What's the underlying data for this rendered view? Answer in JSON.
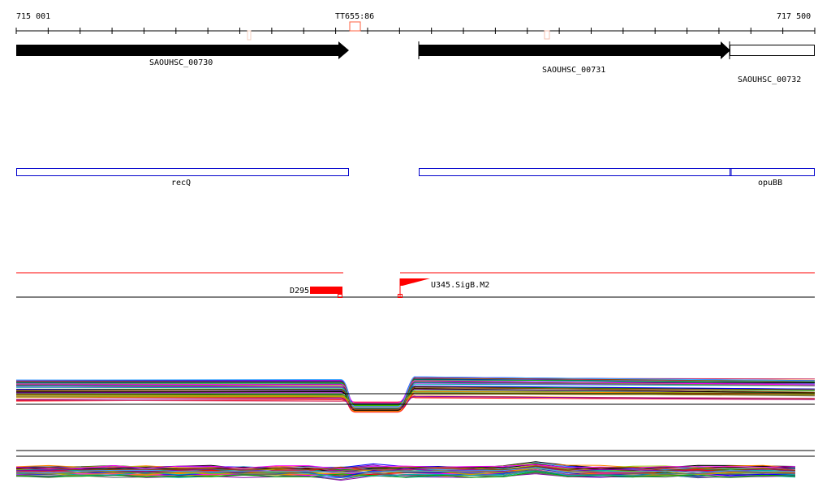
{
  "ruler": {
    "start_label": "715 001",
    "end_label": "717 500",
    "marker_label": "TT655:86"
  },
  "genes": [
    {
      "name": "SAOUHSC_00730",
      "filled": true
    },
    {
      "name": "SAOUHSC_00731",
      "filled": true
    },
    {
      "name": "SAOUHSC_00732",
      "filled": false
    }
  ],
  "annotations": [
    {
      "name": "recQ"
    },
    {
      "name": "opuBB"
    }
  ],
  "promoters": [
    {
      "name": "D295"
    },
    {
      "name": "U345.SigB.M2"
    }
  ],
  "colors": {
    "gene": "#000000",
    "annotation": "#0000cc",
    "promoter": "#ff0000",
    "marker": "#ff6040"
  },
  "trace_colors": [
    "#000000",
    "#ff0000",
    "#00aa00",
    "#0000ff",
    "#ff8800",
    "#8800aa",
    "#00aaaa",
    "#aaaa00",
    "#666666",
    "#ff00ff",
    "#884400",
    "#44aaff",
    "#99cc00",
    "#cc3366"
  ]
}
